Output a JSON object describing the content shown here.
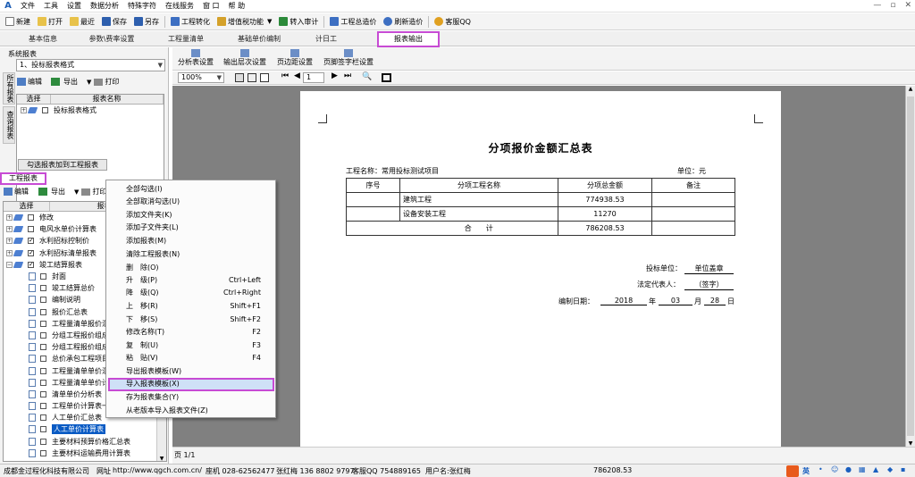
{
  "menubar": {
    "items": [
      "文件",
      "工具",
      "设置",
      "数据分析",
      "特殊字符",
      "在线服务",
      "窗 口",
      "帮 助"
    ],
    "min": "—",
    "restore": "▫",
    "close": "✕"
  },
  "toolbar": {
    "items": [
      "新建",
      "打开",
      "最近",
      "保存",
      "另存",
      "工程转化",
      "增值税功能",
      "转入审计",
      "工程总造价",
      "刷新造价",
      "客服QQ"
    ]
  },
  "tabs": [
    "基本信息",
    "参数\\费率设置",
    "工程量清单",
    "基础单价编制",
    "计日工",
    "报表输出"
  ],
  "left": {
    "system_label": "系统报表",
    "combo_value": "1、投标报表格式",
    "vtab1": "所有报表",
    "vtab2": "查询报表",
    "edit": "编辑",
    "export": "导出",
    "print": "打印",
    "grid_headers": [
      "选择",
      "报表名称"
    ],
    "sys_rows": [
      "投标报表格式"
    ],
    "add_button": "勾选报表加到工程报表",
    "project_label": "工程报表",
    "grid2_headers": [
      "选择",
      "报表名"
    ],
    "project_rows": [
      {
        "t": "修改",
        "lvl": 0,
        "chk": false
      },
      {
        "t": "电风水单价计算表",
        "lvl": 0,
        "chk": false
      },
      {
        "t": "水利招标控制价",
        "lvl": 0,
        "chk": true
      },
      {
        "t": "水利招标清单报表",
        "lvl": 0,
        "chk": true
      },
      {
        "t": "竣工结算报表",
        "lvl": 0,
        "chk": true
      },
      {
        "t": "封面",
        "lvl": 1
      },
      {
        "t": "竣工结算总价",
        "lvl": 1
      },
      {
        "t": "编制说明",
        "lvl": 1
      },
      {
        "t": "报价汇总表",
        "lvl": 1
      },
      {
        "t": "工程量清单报价汇",
        "lvl": 1
      },
      {
        "t": "分组工程报价组成",
        "lvl": 1
      },
      {
        "t": "分组工程报价组成",
        "lvl": 1
      },
      {
        "t": "总价承包工程项目",
        "lvl": 1
      },
      {
        "t": "工程量清单单价汇",
        "lvl": 1
      },
      {
        "t": "工程量清单单价计",
        "lvl": 1
      },
      {
        "t": "清单单价分析表",
        "lvl": 1
      },
      {
        "t": "工程单价计算表一",
        "lvl": 1
      },
      {
        "t": "人工单价汇总表",
        "lvl": 1
      },
      {
        "t": "人工单价计算表",
        "lvl": 1,
        "sel": true
      },
      {
        "t": "主要材料预算价格汇总表",
        "lvl": 1
      },
      {
        "t": "主要材料运输费用计算表",
        "lvl": 1
      },
      {
        "t": "主要材料预算价格计算表",
        "lvl": 1
      }
    ]
  },
  "right": {
    "tools": [
      "分析表设置",
      "输出层次设置",
      "页边距设置",
      "页脚签字栏设置"
    ],
    "zoom": "100%",
    "page_input": "1",
    "page_label": "页 1/1"
  },
  "report": {
    "title": "分项报价金额汇总表",
    "project_name_label": "工程名称：常用投标测试项目",
    "unit_label": "单位：元",
    "headers": [
      "序号",
      "分项工程名称",
      "分项总金额",
      "备注"
    ],
    "rows": [
      [
        "",
        "建筑工程",
        "774938.53",
        ""
      ],
      [
        "",
        "设备安装工程",
        "11270",
        ""
      ]
    ],
    "total_label": "合　　计",
    "total_value": "786208.53",
    "bidder_label": "投标单位：",
    "bidder_value": "单位盖章",
    "rep_label": "法定代表人：",
    "rep_value": "（签字）",
    "date_label": "编制日期：",
    "date_year": "2018",
    "date_y": "年",
    "date_month": "03",
    "date_m": "月",
    "date_day": "28",
    "date_d": "日"
  },
  "context_menu": {
    "items": [
      {
        "label": "全部勾选(I)",
        "sc": ""
      },
      {
        "label": "全部取消勾选(U)",
        "sc": ""
      },
      {
        "label": "添加文件夹(K)",
        "sc": ""
      },
      {
        "label": "添加子文件夹(L)",
        "sc": ""
      },
      {
        "label": "添加报表(M)",
        "sc": ""
      },
      {
        "label": "清除工程报表(N)",
        "sc": ""
      },
      {
        "label": "删　除(O)",
        "sc": ""
      },
      {
        "label": "升　级(P)",
        "sc": "Ctrl+Left"
      },
      {
        "label": "降　级(Q)",
        "sc": "Ctrl+Right"
      },
      {
        "label": "上　移(R)",
        "sc": "Shift+F1"
      },
      {
        "label": "下　移(S)",
        "sc": "Shift+F2"
      },
      {
        "label": "修改名称(T)",
        "sc": "F2"
      },
      {
        "label": "复　制(U)",
        "sc": "F3"
      },
      {
        "label": "粘　贴(V)",
        "sc": "F4"
      },
      {
        "label": "导出报表模板(W)",
        "sc": ""
      },
      {
        "label": "导入报表模板(X)",
        "sc": ""
      },
      {
        "label": "存为报表集合(Y)",
        "sc": ""
      },
      {
        "label": "从老版本导入报表文件(Z)",
        "sc": ""
      }
    ]
  },
  "status": {
    "company": "成都金过程化科技有限公司",
    "website_label": "网址",
    "website": "http://www.qgch.com.cn/",
    "phone": "座机 028-62562477",
    "mobile": "张红梅 136 8802 9797",
    "qq": "客服QQ 754889165",
    "user": "用户名:张红梅",
    "value": "786208.53",
    "ime": "英"
  }
}
